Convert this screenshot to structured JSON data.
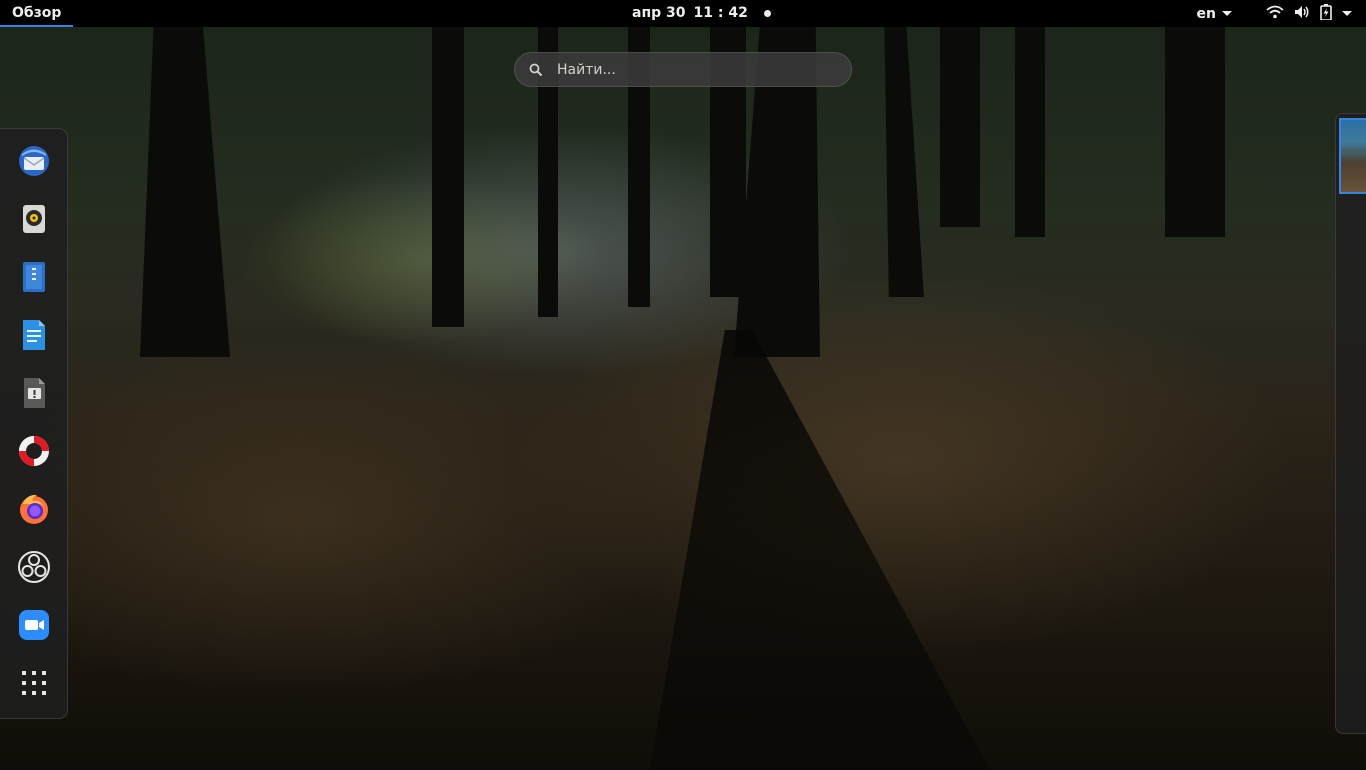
{
  "topbar": {
    "activities_label": "Обзор",
    "date": "апр 30",
    "time": "11 : 42",
    "keyboard_layout": "en"
  },
  "search": {
    "placeholder": "Найти..."
  },
  "dash": {
    "items": [
      {
        "name": "thunderbird-icon"
      },
      {
        "name": "rhythmbox-icon"
      },
      {
        "name": "libreoffice-writer-icon"
      },
      {
        "name": "text-editor-icon"
      },
      {
        "name": "system-monitor-icon"
      },
      {
        "name": "help-icon"
      },
      {
        "name": "firefox-icon"
      },
      {
        "name": "obs-studio-icon"
      },
      {
        "name": "zoom-icon"
      },
      {
        "name": "show-applications-icon"
      }
    ]
  },
  "colors": {
    "accent": "#3584e4",
    "topbar_bg": "#000000",
    "text": "#eeeeec"
  }
}
